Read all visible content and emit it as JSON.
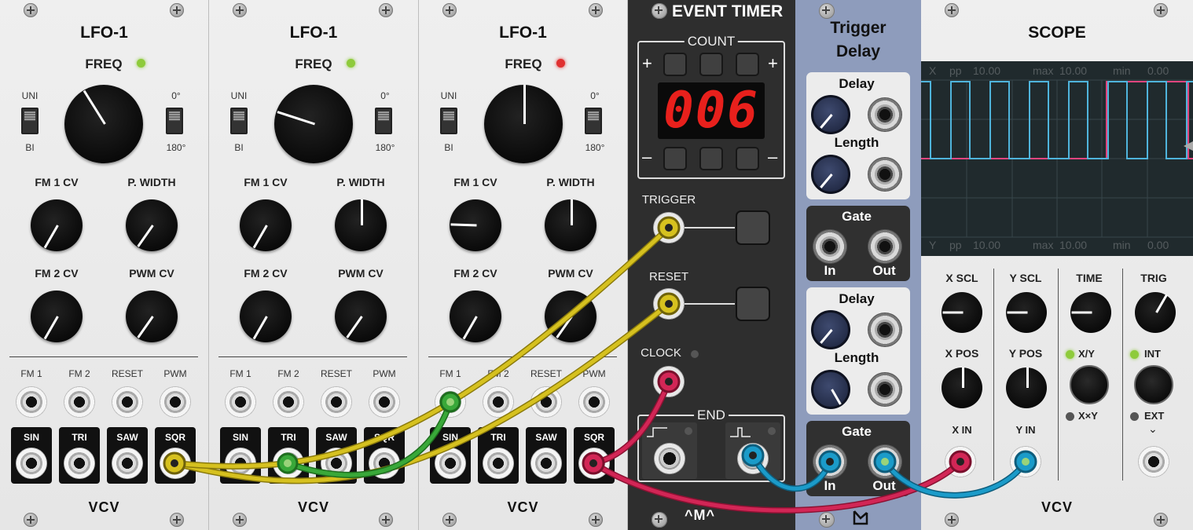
{
  "lfo_modules": [
    {
      "title": "LFO-1",
      "freq_label": "FREQ",
      "freq_led_color": "#8ecb3b",
      "uni_label": "UNI",
      "bi_label": "BI",
      "deg0_label": "0°",
      "deg180_label": "180°",
      "fm1cv_label": "FM 1 CV",
      "pwidth_label": "P. WIDTH",
      "fm2cv_label": "FM 2 CV",
      "pwmcv_label": "PWM CV",
      "inputs": [
        "FM 1",
        "FM 2",
        "RESET",
        "PWM"
      ],
      "outputs": [
        "SIN",
        "TRI",
        "SAW",
        "SQR"
      ],
      "logo": "VCV"
    },
    {
      "title": "LFO-1",
      "freq_label": "FREQ",
      "freq_led_color": "#8ecb3b",
      "uni_label": "UNI",
      "bi_label": "BI",
      "deg0_label": "0°",
      "deg180_label": "180°",
      "fm1cv_label": "FM 1 CV",
      "pwidth_label": "P. WIDTH",
      "fm2cv_label": "FM 2 CV",
      "pwmcv_label": "PWM CV",
      "inputs": [
        "FM 1",
        "FM 2",
        "RESET",
        "PWM"
      ],
      "outputs": [
        "SIN",
        "TRI",
        "SAW",
        "SQR"
      ],
      "logo": "VCV"
    },
    {
      "title": "LFO-1",
      "freq_label": "FREQ",
      "freq_led_color": "#e03030",
      "uni_label": "UNI",
      "bi_label": "BI",
      "deg0_label": "0°",
      "deg180_label": "180°",
      "fm1cv_label": "FM 1 CV",
      "pwidth_label": "P. WIDTH",
      "fm2cv_label": "FM 2 CV",
      "pwmcv_label": "PWM CV",
      "inputs": [
        "FM 1",
        "FM 2",
        "RESET",
        "PWM"
      ],
      "outputs": [
        "SIN",
        "TRI",
        "SAW",
        "SQR"
      ],
      "logo": "VCV"
    }
  ],
  "event_timer": {
    "title": "EVENT TIMER",
    "count_label": "COUNT",
    "plus": "+",
    "minus": "–",
    "display_value": "006",
    "display_color": "#e8201c",
    "trigger_label": "TRIGGER",
    "reset_label": "RESET",
    "clock_label": "CLOCK",
    "end_label": "END",
    "logo": "^M^"
  },
  "trigger_delay": {
    "title_line1": "Trigger",
    "title_line2": "Delay",
    "delay_label": "Delay",
    "length_label": "Length",
    "gate_label": "Gate",
    "in_label": "In",
    "out_label": "Out"
  },
  "scope": {
    "title": "SCOPE",
    "x_readout": {
      "channel": "X",
      "pp": "pp",
      "pp_value": "10.00",
      "max": "max",
      "max_value": "10.00",
      "min": "min",
      "min_value": "0.00"
    },
    "y_readout": {
      "channel": "Y",
      "pp": "pp",
      "pp_value": "10.00",
      "max": "max",
      "max_value": "10.00",
      "min": "min",
      "min_value": "0.00"
    },
    "x_scl_label": "X SCL",
    "y_scl_label": "Y SCL",
    "time_label": "TIME",
    "trig_label": "TRIG",
    "x_pos_label": "X POS",
    "y_pos_label": "Y POS",
    "mode_xy": "X/Y",
    "mode_xxy": "X×Y",
    "trig_int": "INT",
    "trig_ext": "EXT",
    "x_in_label": "X IN",
    "y_in_label": "Y IN",
    "logo": "VCV",
    "trace_x_color": "#4fb4dc",
    "trace_y_color": "#e0457f"
  },
  "cable_colors": {
    "yellow": "#c9b21a",
    "green": "#2f9a2f",
    "red": "#c81e4a",
    "blue": "#1b8db8"
  }
}
